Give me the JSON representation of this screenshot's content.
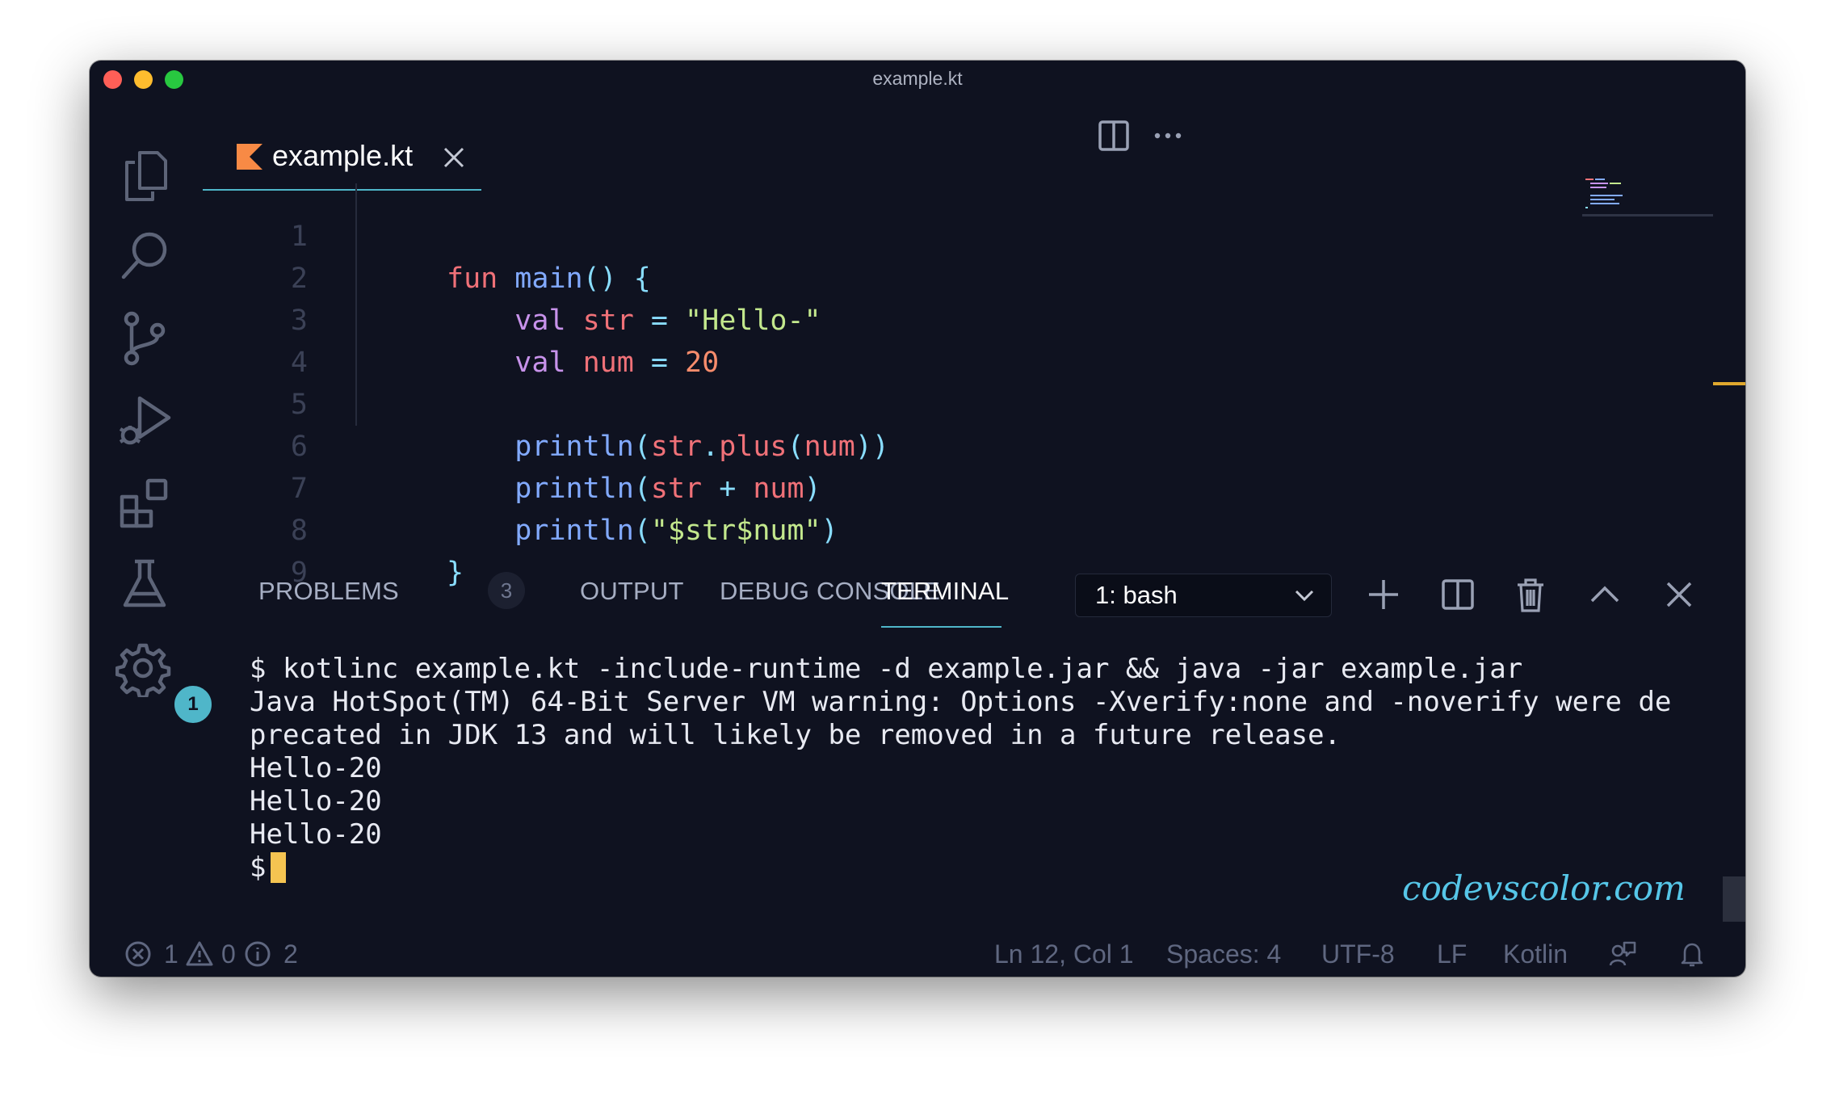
{
  "window": {
    "title": "example.kt"
  },
  "activity_bar": {
    "items": [
      {
        "icon": "files-icon"
      },
      {
        "icon": "search-icon"
      },
      {
        "icon": "source-control-icon"
      },
      {
        "icon": "run-debug-icon"
      },
      {
        "icon": "extensions-icon"
      },
      {
        "icon": "testing-flask-icon"
      }
    ],
    "settings_badge": "1"
  },
  "editor": {
    "tab": {
      "label": "example.kt",
      "icon": "kotlin-icon"
    },
    "line_numbers": [
      "1",
      "2",
      "3",
      "4",
      "5",
      "6",
      "7",
      "8",
      "9"
    ],
    "code": {
      "l1": {
        "kw": "fun",
        "fn": "main",
        "pun": "() {"
      },
      "l2": {
        "kw": "val",
        "name": "str",
        "eq": "=",
        "value": "\"Hello-\""
      },
      "l3": {
        "kw": "val",
        "name": "num",
        "eq": "=",
        "value": "20"
      },
      "l5": {
        "fn": "println",
        "p1": "(",
        "a": "str",
        "dot": ".",
        "m": "plus",
        "p2": "(",
        "b": "num",
        "p3": "))"
      },
      "l6": {
        "fn": "println",
        "p1": "(",
        "a": "str",
        "op": "+",
        "b": "num",
        "p2": ")"
      },
      "l7": {
        "fn": "println",
        "p1": "(",
        "tmpl": "\"$str$num\"",
        "p2": ")"
      },
      "l8": {
        "pun": "}"
      }
    }
  },
  "panel": {
    "tabs": {
      "problems": "PROBLEMS",
      "problems_count": "3",
      "output": "OUTPUT",
      "debug_console": "DEBUG CONSOLE",
      "terminal": "TERMINAL"
    },
    "shell_select": "1: bash",
    "terminal_lines": [
      "$ kotlinc example.kt -include-runtime -d example.jar && java -jar example.jar",
      "Java HotSpot(TM) 64-Bit Server VM warning: Options -Xverify:none and -noverify were de",
      "precated in JDK 13 and will likely be removed in a future release.",
      "Hello-20",
      "Hello-20",
      "Hello-20"
    ],
    "prompt": "$"
  },
  "watermark": "codevscolor.com",
  "status_bar": {
    "errors": "1",
    "warnings": "0",
    "infos": "2",
    "position": "Ln 12, Col 1",
    "spaces": "Spaces: 4",
    "encoding": "UTF-8",
    "eol": "LF",
    "language": "Kotlin"
  },
  "colors": {
    "background": "#0f1220",
    "accent": "#4fb6c9",
    "keyword": "#f07178",
    "function": "#82aaff",
    "variable": "#c792ea",
    "string": "#c3e88d",
    "number": "#f78c6c",
    "cursor": "#f5c451"
  }
}
